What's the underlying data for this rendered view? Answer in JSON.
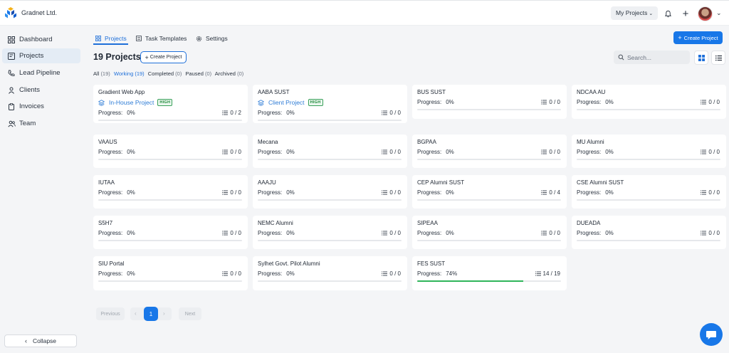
{
  "app": {
    "brand": "Gradnet Ltd."
  },
  "topbar": {
    "my_projects": "My Projects",
    "bell_icon": "bell-icon",
    "plus_icon": "plus-icon"
  },
  "sidebar": {
    "items": [
      {
        "label": "Dashboard",
        "icon": "grid-icon",
        "active": false
      },
      {
        "label": "Projects",
        "icon": "board-icon",
        "active": true
      },
      {
        "label": "Lead Pipeline",
        "icon": "phone-icon",
        "active": false
      },
      {
        "label": "Clients",
        "icon": "user-icon",
        "active": false
      },
      {
        "label": "Invoices",
        "icon": "clipboard-icon",
        "active": false
      },
      {
        "label": "Team",
        "icon": "users-icon",
        "active": false
      }
    ],
    "collapse_label": "Collapse"
  },
  "tabs": [
    {
      "label": "Projects",
      "active": true
    },
    {
      "label": "Task Templates",
      "active": false
    },
    {
      "label": "Settings",
      "active": false
    }
  ],
  "header": {
    "count": "19",
    "title": "Projects",
    "create_small": "Create Project",
    "create_main": "Create Project",
    "search_placeholder": "Search..."
  },
  "filters": [
    {
      "label": "All",
      "count": "(19)",
      "active": false
    },
    {
      "label": "Working",
      "count": "(19)",
      "active": true
    },
    {
      "label": "Completed",
      "count": "(0)",
      "active": false
    },
    {
      "label": "Paused",
      "count": "(0)",
      "active": false
    },
    {
      "label": "Archived",
      "count": "(0)",
      "active": false
    }
  ],
  "progress_label": "Progress:",
  "projects": [
    {
      "name": "Gradient Web App",
      "type": "In-House Project",
      "priority": "HIGH",
      "progress": "0%",
      "tasks": "0 / 2",
      "pct": 0
    },
    {
      "name": "AABA SUST",
      "type": "Client Project",
      "priority": "HIGH",
      "progress": "0%",
      "tasks": "0 / 0",
      "pct": 0
    },
    {
      "name": "BUS SUST",
      "progress": "0%",
      "tasks": "0 / 0",
      "pct": 0
    },
    {
      "name": "NDCAA AU",
      "progress": "0%",
      "tasks": "0 / 0",
      "pct": 0
    },
    {
      "name": "VAAUS",
      "progress": "0%",
      "tasks": "0 / 0",
      "pct": 0
    },
    {
      "name": "Mecana",
      "progress": "0%",
      "tasks": "0 / 0",
      "pct": 0
    },
    {
      "name": "BGPAA",
      "progress": "0%",
      "tasks": "0 / 0",
      "pct": 0
    },
    {
      "name": "MU Alumni",
      "progress": "0%",
      "tasks": "0 / 0",
      "pct": 0
    },
    {
      "name": "IUTAA",
      "progress": "0%",
      "tasks": "0 / 0",
      "pct": 0
    },
    {
      "name": "AAAJU",
      "progress": "0%",
      "tasks": "0 / 0",
      "pct": 0
    },
    {
      "name": "CEP Alumni SUST",
      "progress": "0%",
      "tasks": "0 / 4",
      "pct": 0
    },
    {
      "name": "CSE Alumni SUST",
      "progress": "0%",
      "tasks": "0 / 0",
      "pct": 0
    },
    {
      "name": "S5H7",
      "progress": "0%",
      "tasks": "0 / 0",
      "pct": 0
    },
    {
      "name": "NEMC Alumni",
      "progress": "0%",
      "tasks": "0 / 0",
      "pct": 0
    },
    {
      "name": "SIPEAA",
      "progress": "0%",
      "tasks": "0 / 0",
      "pct": 0
    },
    {
      "name": "DUEADA",
      "progress": "0%",
      "tasks": "0 / 0",
      "pct": 0
    },
    {
      "name": "SIU Portal",
      "progress": "0%",
      "tasks": "0 / 0",
      "pct": 0
    },
    {
      "name": "Sylhet Govt. Pilot Alumni",
      "progress": "0%",
      "tasks": "0 / 0",
      "pct": 0
    },
    {
      "name": "FES SUST",
      "progress": "74%",
      "tasks": "14 / 19",
      "pct": 74
    }
  ],
  "pagination": {
    "prev": "Previous",
    "next": "Next",
    "current": "1",
    "left_arrow": "‹",
    "right_arrow": "›"
  },
  "colors": {
    "accent": "#1877e8",
    "progress_fill": "#2fb55a",
    "badge_green": "#1f8a3a"
  }
}
